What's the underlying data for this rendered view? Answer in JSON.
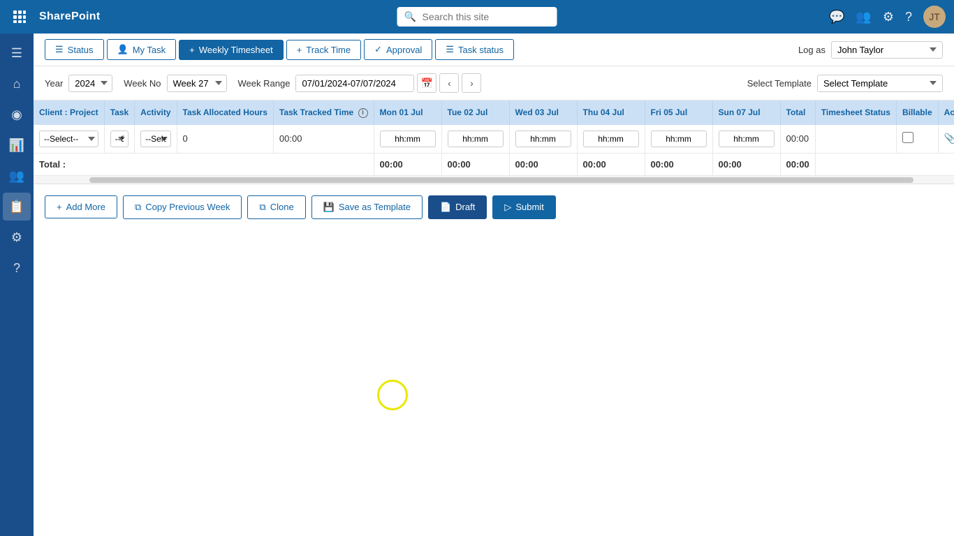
{
  "topNav": {
    "brand": "SharePoint",
    "searchPlaceholder": "Search this site"
  },
  "toolbar": {
    "tabs": [
      {
        "id": "status",
        "label": "Status",
        "icon": "☰",
        "active": false
      },
      {
        "id": "my-task",
        "label": "My Task",
        "icon": "👤",
        "active": false
      },
      {
        "id": "weekly-timesheet",
        "label": "Weekly Timesheet",
        "icon": "+",
        "active": true
      },
      {
        "id": "track-time",
        "label": "Track Time",
        "icon": "+",
        "active": false
      },
      {
        "id": "approval",
        "label": "Approval",
        "icon": "✓",
        "active": false
      },
      {
        "id": "task-status",
        "label": "Task status",
        "icon": "☰",
        "active": false
      }
    ],
    "logAsLabel": "Log as",
    "logAsValue": "John Taylor"
  },
  "filters": {
    "yearLabel": "Year",
    "yearValue": "2024",
    "weekNoLabel": "Week No",
    "weekNoValue": "Week 27",
    "weekRangeLabel": "Week Range",
    "weekRangeValue": "07/01/2024-07/07/2024",
    "selectTemplateLabel": "Select Template",
    "selectTemplateValue": "Select Template"
  },
  "table": {
    "headers": [
      "Client : Project",
      "Task",
      "Activity",
      "Task Allocated Hours",
      "Task Tracked Time",
      "Mon 01 Jul",
      "Tue 02 Jul",
      "Wed 03 Jul",
      "Thu 04 Jul",
      "Fri 05 Jul",
      "Sun 07 Jul",
      "Total",
      "Timesheet Status",
      "Billable",
      "Acti"
    ],
    "rows": [
      {
        "client": "--Select--",
        "task": "--Select--",
        "activity": "--Select--",
        "allocated": "0",
        "tracked": "00:00",
        "mon": "hh:mm",
        "tue": "hh:mm",
        "wed": "hh:mm",
        "thu": "hh:mm",
        "fri": "hh:mm",
        "sun": "hh:mm",
        "total": "00:00",
        "status": "",
        "billable": false
      }
    ],
    "totals": {
      "label": "Total :",
      "mon": "00:00",
      "tue": "00:00",
      "wed": "00:00",
      "thu": "00:00",
      "fri": "00:00",
      "sun": "00:00",
      "total": "00:00"
    }
  },
  "actions": {
    "addMore": "+ Add More",
    "copyPreviousWeek": "Copy Previous Week",
    "clone": "Clone",
    "saveAsTemplate": "Save as Template",
    "draft": "Draft",
    "submit": "Submit"
  },
  "sidebar": {
    "items": [
      {
        "id": "menu",
        "icon": "☰",
        "active": false
      },
      {
        "id": "home",
        "icon": "⌂",
        "active": false
      },
      {
        "id": "camera",
        "icon": "◉",
        "active": false
      },
      {
        "id": "chart",
        "icon": "📊",
        "active": false
      },
      {
        "id": "people",
        "icon": "👥",
        "active": false
      },
      {
        "id": "timesheet",
        "icon": "📋",
        "active": true
      },
      {
        "id": "settings",
        "icon": "⚙",
        "active": false
      },
      {
        "id": "help",
        "icon": "?",
        "active": false
      }
    ]
  }
}
